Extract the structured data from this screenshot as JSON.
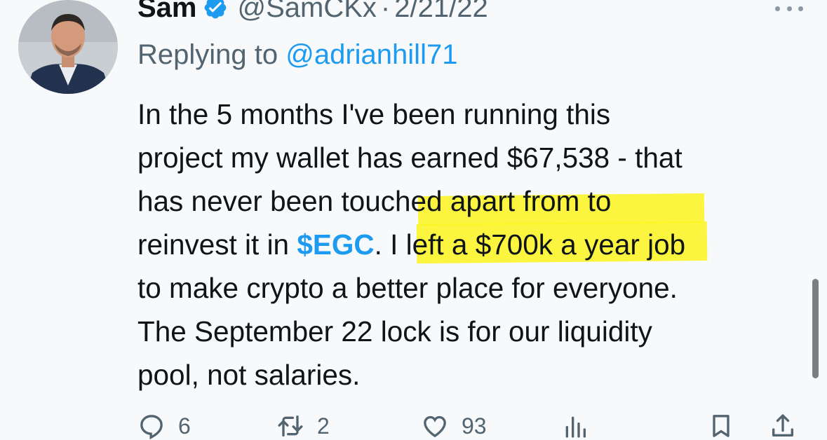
{
  "author": {
    "display_name": "Sam",
    "handle": "@SamCKx",
    "separator": "·",
    "date": "2/21/22",
    "verified": true
  },
  "reply": {
    "prefix": "Replying to",
    "mention": "@adrianhill71"
  },
  "tweet": {
    "line1": "In the 5 months I've been running this",
    "line2": "project my wallet has earned $67,538 - that",
    "line3": "has never been touched apart from to",
    "line4_a": "reinvest it in ",
    "line4_cashtag": "$EGC",
    "line4_b": ". I left a $700k a year job",
    "line5": "to make crypto a better place for everyone.",
    "line6": "The September 22 lock is for our liquidity",
    "line7": "pool, not salaries."
  },
  "actions": {
    "replies": "6",
    "retweets": "2",
    "likes": "93"
  },
  "colors": {
    "accent": "#1d9bf0",
    "highlight": "#fbf51f",
    "muted": "#536471"
  }
}
